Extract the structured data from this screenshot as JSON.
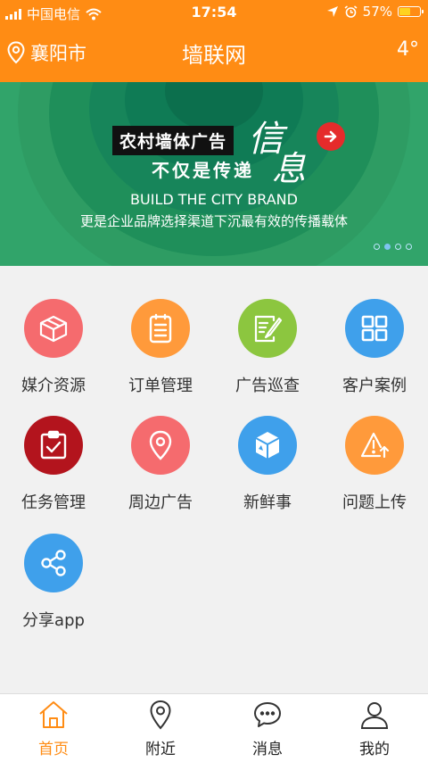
{
  "status_bar": {
    "carrier": "中国电信",
    "time": "17:54",
    "battery": "57%",
    "battery_level": 0.57
  },
  "header": {
    "location": "襄阳市",
    "title": "墙联网",
    "temperature": "4°"
  },
  "banner": {
    "headline_box": "农村墙体广告",
    "headline_big_1": "信",
    "headline_big_2": "息",
    "subline": "不仅是传递",
    "brand": "BUILD THE CITY BRAND",
    "slogan": "更是企业品牌选择渠道下沉最有效的传播载体",
    "dots_total": 4,
    "dots_active": 2
  },
  "menu": [
    {
      "label": "媒介资源",
      "icon": "box-icon",
      "color": "#f56b6e"
    },
    {
      "label": "订单管理",
      "icon": "clipboard-list-icon",
      "color": "#ff9a3b"
    },
    {
      "label": "广告巡查",
      "icon": "document-edit-icon",
      "color": "#8cc63f"
    },
    {
      "label": "客户案例",
      "icon": "grid-icon",
      "color": "#3fa0eb"
    },
    {
      "label": "任务管理",
      "icon": "clipboard-check-icon",
      "color": "#b3141d"
    },
    {
      "label": "周边广告",
      "icon": "location-pin-icon",
      "color": "#f56b6e"
    },
    {
      "label": "新鲜事",
      "icon": "cube-icon",
      "color": "#3fa0eb"
    },
    {
      "label": "问题上传",
      "icon": "warning-upload-icon",
      "color": "#ff9a3b"
    },
    {
      "label": "分享app",
      "icon": "share-icon",
      "color": "#3fa0eb"
    }
  ],
  "tabs": [
    {
      "label": "首页",
      "icon": "home-icon",
      "active": true
    },
    {
      "label": "附近",
      "icon": "location-pin-icon",
      "active": false
    },
    {
      "label": "消息",
      "icon": "message-icon",
      "active": false
    },
    {
      "label": "我的",
      "icon": "user-icon",
      "active": false
    }
  ],
  "colors": {
    "accent": "#ff8c14",
    "banner_green": "#31a46a"
  }
}
